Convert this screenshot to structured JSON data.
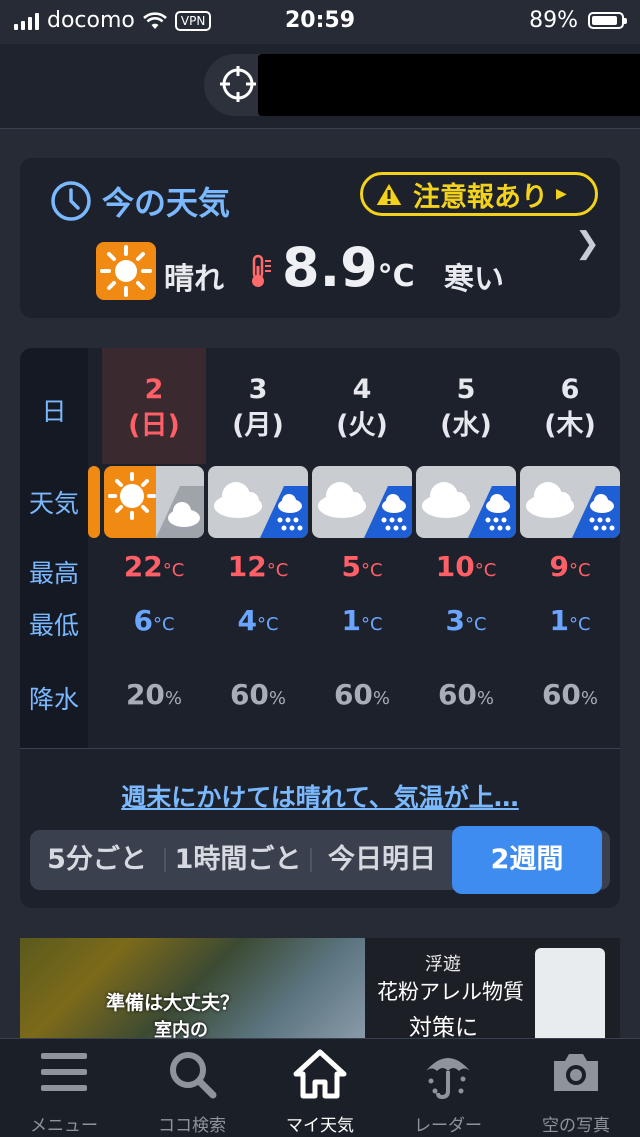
{
  "status_bar": {
    "carrier": "docomo",
    "vpn": "VPN",
    "time": "20:59",
    "battery_percent": "89%",
    "battery_level": 0.89
  },
  "header": {
    "location_icon": "crosshair-location-icon"
  },
  "current": {
    "title": "今の天気",
    "alert_label": "注意報あり",
    "condition": "晴れ",
    "temperature": "8.9",
    "temp_unit": "°C",
    "feeling": "寒い"
  },
  "forecast": {
    "row_labels": {
      "day": "日",
      "weather": "天気",
      "high": "最高",
      "low": "最低",
      "precip": "降水"
    },
    "days": [
      {
        "num": "2",
        "wd": "(日)",
        "icon": "sun-then-cloud-icon",
        "high": "22",
        "low": "6",
        "precip": "20"
      },
      {
        "num": "3",
        "wd": "(月)",
        "icon": "cloud-then-rain-icon",
        "high": "12",
        "low": "4",
        "precip": "60"
      },
      {
        "num": "4",
        "wd": "(火)",
        "icon": "cloud-then-rain-icon",
        "high": "5",
        "low": "1",
        "precip": "60"
      },
      {
        "num": "5",
        "wd": "(水)",
        "icon": "cloud-then-rain-icon",
        "high": "10",
        "low": "3",
        "precip": "60"
      },
      {
        "num": "6",
        "wd": "(木)",
        "icon": "cloud-then-rain-icon",
        "high": "9",
        "low": "1",
        "precip": "60"
      }
    ],
    "temp_unit": "°C",
    "precip_unit": "%",
    "summary": "週末にかけては晴れて、気温が上…",
    "segments": [
      "5分ごと",
      "1時間ごと",
      "今日明日",
      "2週間"
    ],
    "active_segment": "2週間"
  },
  "ad": {
    "left_line1": "準備は大丈夫？",
    "left_line2": "室内の",
    "right_line1": "浮遊",
    "right_line2": "花粉アレル物質",
    "right_line3": "対策に"
  },
  "tabbar": [
    {
      "label": "メニュー",
      "icon": "menu-icon"
    },
    {
      "label": "ココ検索",
      "icon": "search-icon"
    },
    {
      "label": "マイ天気",
      "icon": "home-icon"
    },
    {
      "label": "レーダー",
      "icon": "umbrella-radar-icon"
    },
    {
      "label": "空の写真",
      "icon": "camera-icon"
    }
  ],
  "colors": {
    "accent": "#3f8cf1",
    "high": "#ff5f67",
    "low": "#6aa6ff",
    "alert": "#f3d21c",
    "sun_box": "#f08a12"
  }
}
